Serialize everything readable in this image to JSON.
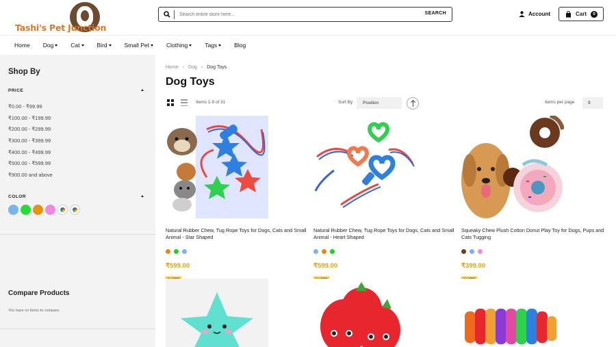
{
  "header": {
    "logo_text": "Tashi's Pet Junction",
    "search_placeholder": "Search entire store here...",
    "search_button": "SEARCH",
    "account_label": "Account",
    "cart_label": "Cart",
    "cart_count": "0"
  },
  "nav": {
    "items": [
      {
        "label": "Home",
        "dropdown": false
      },
      {
        "label": "Dog",
        "dropdown": true
      },
      {
        "label": "Cat",
        "dropdown": true
      },
      {
        "label": "Bird",
        "dropdown": true
      },
      {
        "label": "Small Pet",
        "dropdown": true
      },
      {
        "label": "Clothing",
        "dropdown": true
      },
      {
        "label": "Tags",
        "dropdown": true
      },
      {
        "label": "Blog",
        "dropdown": false
      }
    ]
  },
  "sidebar": {
    "title": "Shop By",
    "price_heading": "PRICE",
    "price_ranges": [
      "₹0.00 - ₹99.99",
      "₹100.00 - ₹199.99",
      "₹200.00 - ₹299.99",
      "₹300.00 - ₹399.99",
      "₹400.00 - ₹499.99",
      "₹500.00 - ₹599.99",
      "₹900.00 and above"
    ],
    "color_heading": "COLOR",
    "color_swatches": [
      "#78b4ee",
      "#22dd33",
      "#e8920e",
      "#ee88e0",
      "multi-red",
      "multi-yellow"
    ],
    "compare_title": "Compare Products",
    "compare_text": "You have no items to compare."
  },
  "breadcrumb": {
    "items": [
      "Home",
      "Dog",
      "Dog Toys"
    ]
  },
  "page_title": "Dog Toys",
  "toolbar": {
    "items_count": "Items 1-9 of 31",
    "sort_label": "Sort By",
    "sort_value": "Position",
    "per_page_label": "Items per page",
    "per_page_value": "9"
  },
  "products": [
    {
      "name": "Natural Rubber Chew, Tug Rope Toys for Dogs, Cats and Small Animal - Star Shaped",
      "price": "₹599.00",
      "colors": [
        "#e08a1e",
        "#22cc33",
        "#78b4ee"
      ],
      "badge": "1 LEFT"
    },
    {
      "name": "Natural Rubber Chew, Tug Rope Toys for Dogs, Cats and Small Animal - Heart Shaped",
      "price": "₹599.00",
      "colors": [
        "#78b4ee",
        "#e08a1e",
        "#22cc33"
      ],
      "badge": "1 LEFT"
    },
    {
      "name": "Squeaky Chew Plush Cotton Donut Play Toy for Dogs, Pups and Cats Tugging",
      "price": "₹399.00",
      "colors": [
        "#6b3f1e",
        "#78b4ee",
        "#ee88e0"
      ],
      "badge": "1 LEFT"
    }
  ]
}
